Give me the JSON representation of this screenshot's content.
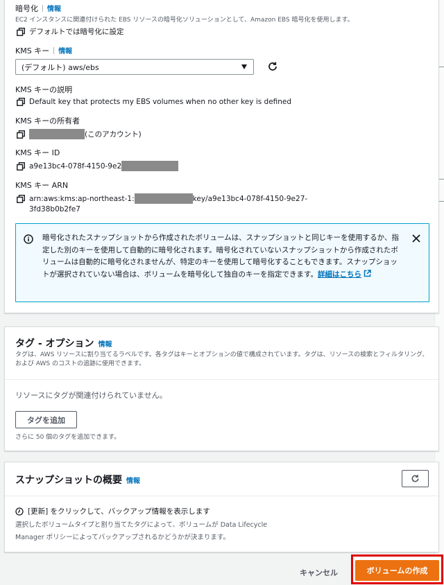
{
  "encryption": {
    "title": "暗号化",
    "info": "情報",
    "description": "EC2 インスタンスに関連付けられた EBS リソースの暗号化ソリューションとして、Amazon EBS 暗号化を使用します。",
    "default_note": "デフォルトでは暗号化に設定",
    "kms_key_label": "KMS キー",
    "kms_key_info": "情報",
    "kms_key_selected": "(デフォルト) aws/ebs",
    "kms_desc_label": "KMS キーの説明",
    "kms_desc_value": "Default key that protects my EBS volumes when no other key is defined",
    "kms_owner_label": "KMS キーの所有者",
    "kms_owner_suffix": "(このアカウント)",
    "kms_id_label": "KMS キー ID",
    "kms_id_value": "a9e13bc4-078f-4150-9e2",
    "kms_arn_label": "KMS キー ARN",
    "kms_arn_prefix": "arn:aws:kms:ap-northeast-1:",
    "kms_arn_suffix": "key/a9e13bc4-078f-4150-9e27-",
    "kms_arn_line2": "3fd38b0b2fe7",
    "alert_text": "暗号化されたスナップショットから作成されたボリュームは、スナップショットと同じキーを使用するか、指定した別のキーを使用して自動的に暗号化されます。暗号化されていないスナップショットから作成されたボリュームは自動的に暗号化されませんが、特定のキーを使用して暗号化することもできます。スナップショットが選択されていない場合は、ボリュームを暗号化して独自のキーを指定できます。",
    "alert_link": "詳細はこちら"
  },
  "tags": {
    "title": "タグ - オプション",
    "info": "情報",
    "description": "タグは、AWS リソースに割り当てるラベルです。各タグはキーとオプションの値で構成されています。タグは、リソースの検索とフィルタリング、および AWS のコストの追跡に使用できます。",
    "empty_text": "リソースにタグが関連付けられていません。",
    "add_button": "タグを追加",
    "hint": "さらに 50 個のタグを追加できます。"
  },
  "snapshot": {
    "title": "スナップショットの概要",
    "info": "情報",
    "refresh_hint": "[更新] をクリックして、バックアップ情報を表示します",
    "detail_line1": "選択したボリュームタイプと割り当てたタグによって、ボリュームが Data Lifecycle",
    "detail_line2": "Manager ポリシーによってバックアップされるかどうかが決まります。"
  },
  "footer": {
    "cancel": "キャンセル",
    "create": "ボリュームの作成"
  },
  "colors": {
    "accent": "#ec7211",
    "link": "#0073bb",
    "alert_border": "#00a1c9",
    "highlight": "#e00000"
  }
}
